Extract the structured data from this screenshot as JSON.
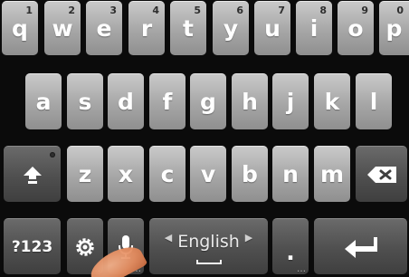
{
  "keyboard": {
    "row1": [
      {
        "label": "q",
        "hint": "1"
      },
      {
        "label": "w",
        "hint": "2"
      },
      {
        "label": "e",
        "hint": "3"
      },
      {
        "label": "r",
        "hint": "4"
      },
      {
        "label": "t",
        "hint": "5"
      },
      {
        "label": "y",
        "hint": "6"
      },
      {
        "label": "u",
        "hint": "7"
      },
      {
        "label": "i",
        "hint": "8"
      },
      {
        "label": "o",
        "hint": "9"
      },
      {
        "label": "p",
        "hint": "0"
      }
    ],
    "row2": [
      "a",
      "s",
      "d",
      "f",
      "g",
      "h",
      "j",
      "k",
      "l"
    ],
    "row3": [
      "z",
      "x",
      "c",
      "v",
      "b",
      "n",
      "m"
    ],
    "symbols_label": "?123",
    "language_label": "English",
    "period_label": ".",
    "shift_icon": "shift-arrow-icon",
    "delete_icon": "backspace-icon",
    "settings_icon": "gear-icon",
    "mic_icon": "microphone-icon",
    "enter_icon": "return-arrow-icon",
    "key_color": "#a6a6a6",
    "function_key_color": "#4f4f4f",
    "background_color": "#0b0b0b"
  }
}
